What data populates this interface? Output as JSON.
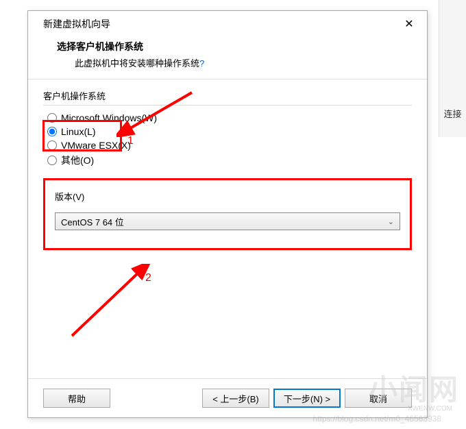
{
  "dialog": {
    "window_title": "新建虚拟机向导",
    "header_title": "选择客户机操作系统",
    "header_subtitle": "此虚拟机中将安装哪种操作系统",
    "header_subtitle_q": "?"
  },
  "os_group": {
    "label": "客户机操作系统",
    "options": [
      {
        "label": "Microsoft Windows(W)",
        "value": "windows",
        "checked": false
      },
      {
        "label": "Linux(L)",
        "value": "linux",
        "checked": true
      },
      {
        "label": "VMware ESX(X)",
        "value": "esx",
        "checked": false
      },
      {
        "label": "其他(O)",
        "value": "other",
        "checked": false
      }
    ]
  },
  "version": {
    "label": "版本(V)",
    "selected": "CentOS 7 64 位"
  },
  "footer": {
    "help": "帮助",
    "back": "< 上一步(B)",
    "next": "下一步(N) >",
    "cancel": "取消"
  },
  "side": {
    "text": "连接"
  },
  "annotations": {
    "label1": "1",
    "label2": "2",
    "arrow_color": "#ff0000"
  },
  "watermark": {
    "main": "小闻网",
    "sub1": "XWENW.COM",
    "sub2": "https://blog.csdn.net/m0_46563938"
  }
}
